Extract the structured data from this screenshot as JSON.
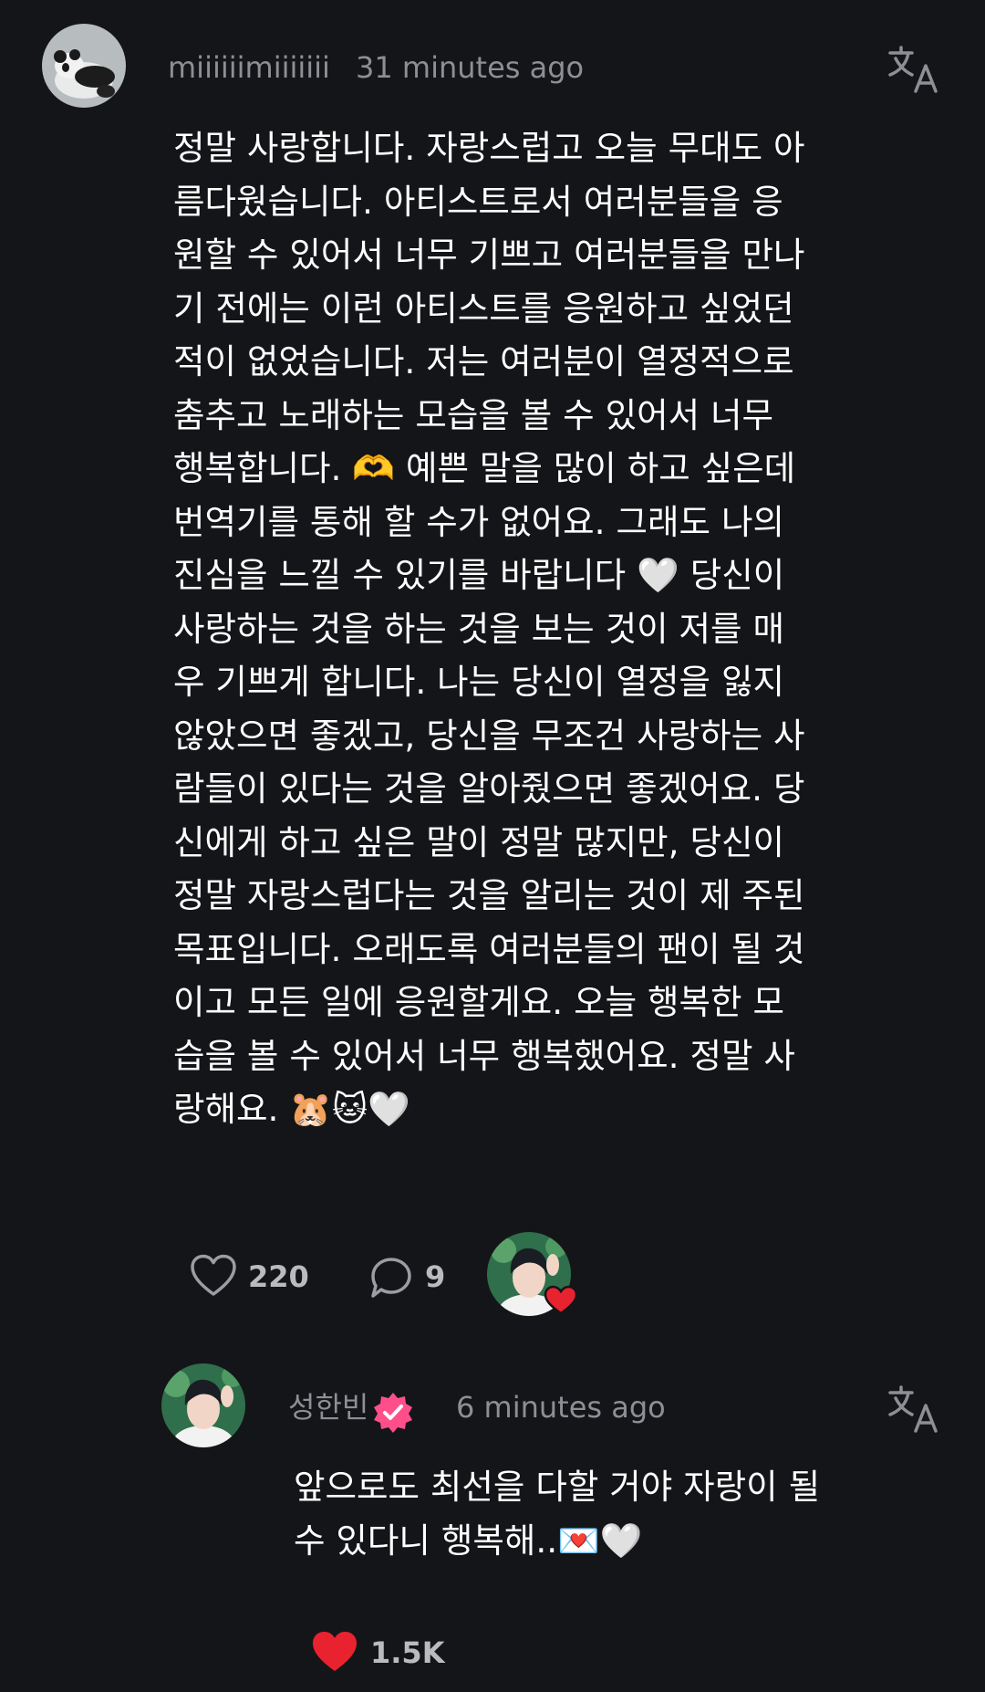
{
  "post": {
    "author": {
      "username": "miiiiiimiiiiiii",
      "avatar_icon": "panda-avatar"
    },
    "timestamp": "31 minutes ago",
    "translate_icon": "translate-icon",
    "body": "정말 사랑합니다. 자랑스럽고 오늘 무대도 아름다웠습니다. 아티스트로서 여러분들을 응원할 수 있어서 너무 기쁘고 여러분들을 만나기 전에는 이런 아티스트를 응원하고 싶었던 적이 없었습니다. 저는 여러분이 열정적으로 춤추고 노래하는 모습을 볼 수 있어서 너무 행복합니다. 🫶 예쁜 말을 많이 하고 싶은데 번역기를 통해 할 수가 없어요. 그래도 나의 진심을 느낄 수 있기를 바랍니다 🤍 당신이 사랑하는 것을 하는 것을 보는 것이 저를 매우 기쁘게 합니다. 나는 당신이 열정을 잃지 않았으면 좋겠고, 당신을 무조건 사랑하는 사람들이 있다는 것을 알아줬으면 좋겠어요. 당신에게 하고 싶은 말이 정말 많지만, 당신이 정말 자랑스럽다는 것을 알리는 것이 제 주된 목표입니다. 오래도록 여러분들의 팬이 될 것이고 모든 일에 응원할게요. 오늘 행복한 모습을 볼 수 있어서 너무 행복했어요. 정말 사랑해요. 🐹🐱🤍",
    "likes": "220",
    "comments": "9",
    "liked_by_artist_icon": "artist-heart-avatar"
  },
  "reply": {
    "author": {
      "username": "성한빈",
      "verified_icon": "verified-badge-icon",
      "avatar_icon": "artist-avatar"
    },
    "timestamp": "6 minutes ago",
    "translate_icon": "translate-icon",
    "body": "앞으로도 최선을 다할 거야 자랑이 될 수 있다니 행복해..💌🤍",
    "likes": "1.5K"
  },
  "colors": {
    "background": "#141518",
    "meta_text": "#8d8f94",
    "heart_active": "#e8232f",
    "verified": "#ff4f8b"
  }
}
